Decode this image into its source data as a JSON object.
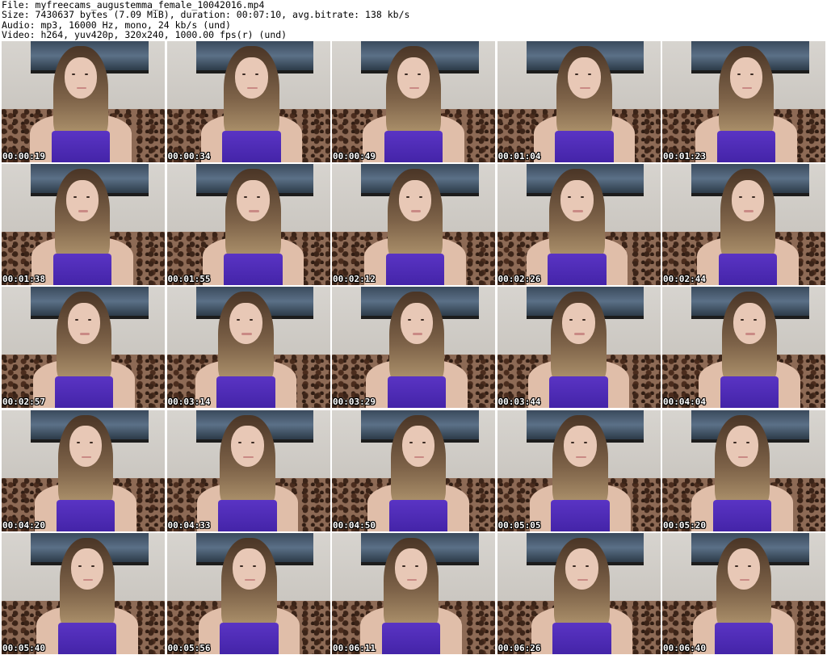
{
  "header": {
    "file": "File: myfreecams_augustemma_female_10042016.mp4",
    "size": "Size: 7430637 bytes (7.09 MiB), duration: 00:07:10, avg.bitrate: 138 kb/s",
    "audio": "Audio: mp3, 16000 Hz, mono, 24 kb/s (und)",
    "video": "Video: h264, yuv420p, 320x240, 1000.00 fps(r) (und)"
  },
  "thumbnails": [
    {
      "timestamp": "00:00:19"
    },
    {
      "timestamp": "00:00:34"
    },
    {
      "timestamp": "00:00:49"
    },
    {
      "timestamp": "00:01:04"
    },
    {
      "timestamp": "00:01:23"
    },
    {
      "timestamp": "00:01:38"
    },
    {
      "timestamp": "00:01:55"
    },
    {
      "timestamp": "00:02:12"
    },
    {
      "timestamp": "00:02:26"
    },
    {
      "timestamp": "00:02:44"
    },
    {
      "timestamp": "00:02:57"
    },
    {
      "timestamp": "00:03:14"
    },
    {
      "timestamp": "00:03:29"
    },
    {
      "timestamp": "00:03:44"
    },
    {
      "timestamp": "00:04:04"
    },
    {
      "timestamp": "00:04:20"
    },
    {
      "timestamp": "00:04:33"
    },
    {
      "timestamp": "00:04:50"
    },
    {
      "timestamp": "00:05:05"
    },
    {
      "timestamp": "00:05:20"
    },
    {
      "timestamp": "00:05:40"
    },
    {
      "timestamp": "00:05:56"
    },
    {
      "timestamp": "00:06:11"
    },
    {
      "timestamp": "00:06:26"
    },
    {
      "timestamp": "00:06:40"
    }
  ],
  "colors": {
    "background": "#ffffff",
    "header_text": "#000000",
    "timestamp_text": "#ffffff",
    "top_garment": "#4a2ab0"
  }
}
